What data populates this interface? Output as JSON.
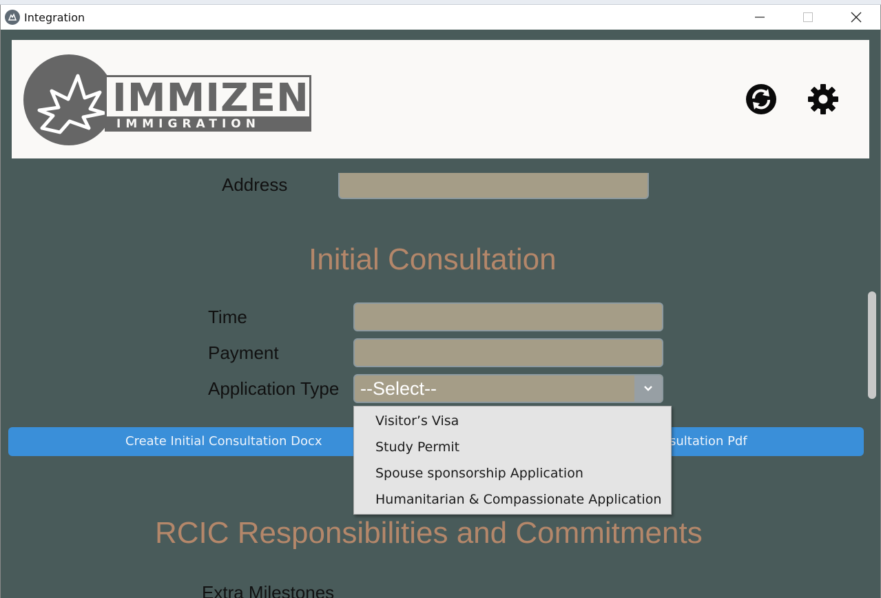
{
  "window": {
    "title": "Integration",
    "controls": {
      "minimize": "—",
      "maximize": "☐",
      "close": "✕"
    }
  },
  "header": {
    "logo": {
      "main": "IMMIZEN",
      "sub": "IMMIGRATION"
    },
    "icons": [
      "sync-icon",
      "gear-icon"
    ]
  },
  "form": {
    "address_label": "Address",
    "address_value": "",
    "initial_consultation": {
      "title": "Initial Consultation",
      "time_label": "Time",
      "time_value": "",
      "payment_label": "Payment",
      "payment_value": "",
      "application_type_label": "Application Type",
      "application_type_value": "--Select--",
      "options": [
        "Visitor’s Visa",
        "Study Permit",
        "Spouse sponsorship Application",
        "Humanitarian & Compassionate Application"
      ]
    },
    "actions": {
      "docx_label": "Create Initial Consultation Docx",
      "pdf_label_partial": "sultation Pdf"
    },
    "rcic": {
      "title": "RCIC Responsibilities and Commitments",
      "extra_milestones_label": "Extra Milestones"
    }
  },
  "colors": {
    "background": "#495b5a",
    "field": "#a59d87",
    "section_title": "#b4876a",
    "action_bar": "#3a8fd9",
    "dropdown": "#e4e4e4"
  }
}
